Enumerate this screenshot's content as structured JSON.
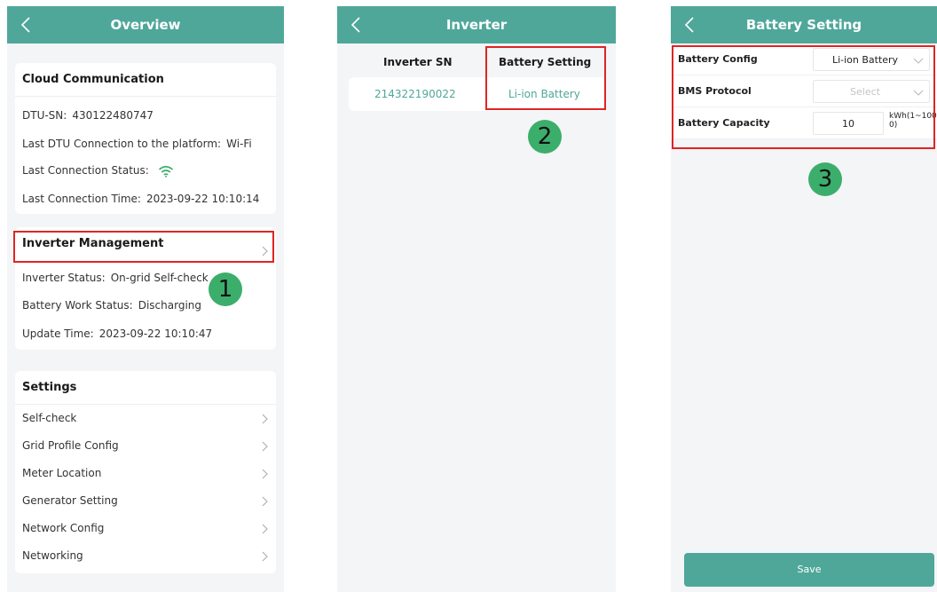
{
  "panel1": {
    "title": "Overview",
    "cloud": {
      "heading": "Cloud Communication",
      "dtu_sn_label": "DTU-SN:",
      "dtu_sn_value": "430122480747",
      "last_dtu_label": "Last DTU Connection to the platform:",
      "last_dtu_value": "Wi-Fi",
      "status_label": "Last Connection Status:",
      "status_icon": "wifi-icon",
      "time_label": "Last Connection Time:",
      "time_value": "2023-09-22 10:10:14"
    },
    "inverter": {
      "heading": "Inverter Management",
      "status_label": "Inverter Status:",
      "status_value": "On-grid Self-check",
      "battery_label": "Battery Work Status:",
      "battery_value": "Discharging",
      "update_label": "Update Time:",
      "update_value": "2023-09-22 10:10:47"
    },
    "settings": {
      "heading": "Settings",
      "items": [
        "Self-check",
        "Grid Profile Config",
        "Meter Location",
        "Generator Setting",
        "Network Config",
        "Networking"
      ]
    },
    "step": "1"
  },
  "panel2": {
    "title": "Inverter",
    "col_sn": "Inverter SN",
    "col_battery": "Battery Setting",
    "sn_value": "214322190022",
    "battery_value": "Li-ion Battery",
    "step": "2"
  },
  "panel3": {
    "title": "Battery Setting",
    "battery_config_label": "Battery Config",
    "battery_config_value": "Li-ion Battery",
    "bms_label": "BMS Protocol",
    "bms_placeholder": "Select",
    "capacity_label": "Battery Capacity",
    "capacity_value": "10",
    "capacity_unit_line1": "kWh(1~100",
    "capacity_unit_line2": "0)",
    "save_label": "Save",
    "step": "3"
  },
  "colors": {
    "accent": "#4fa79a",
    "highlight": "#e02424",
    "badge": "#3cae6b"
  }
}
